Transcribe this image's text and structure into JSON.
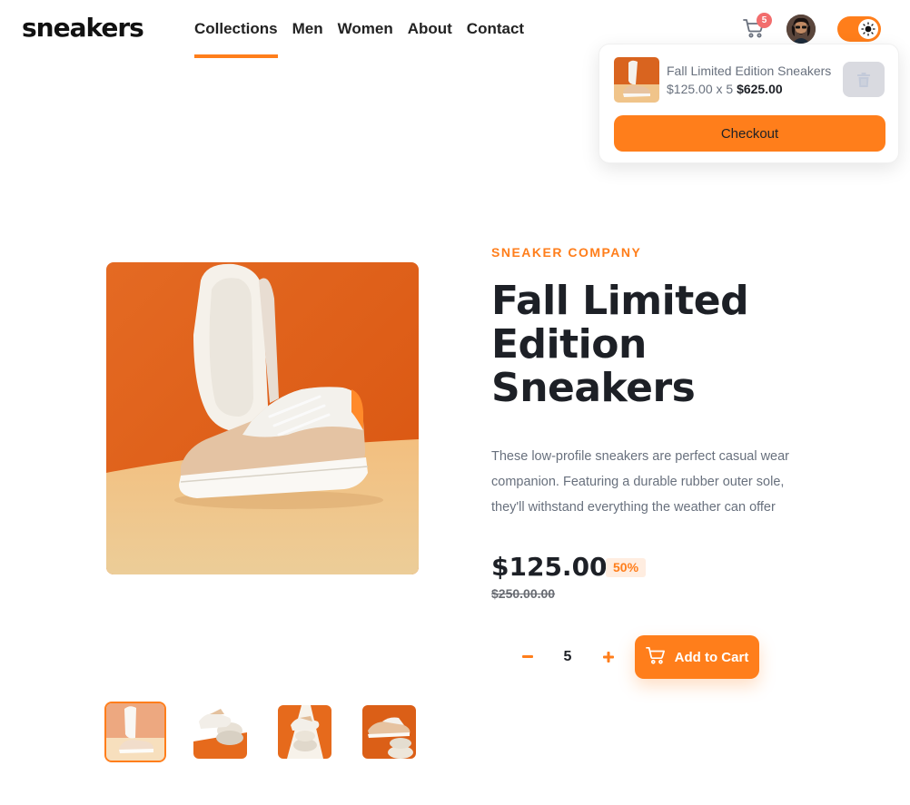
{
  "header": {
    "logo": "sneakers",
    "nav": [
      {
        "label": "Collections",
        "active": true
      },
      {
        "label": "Men",
        "active": false
      },
      {
        "label": "Women",
        "active": false
      },
      {
        "label": "About",
        "active": false
      },
      {
        "label": "Contact",
        "active": false
      }
    ],
    "cart_count": "5",
    "cart_icon": "cart-icon",
    "avatar": "user-avatar",
    "theme_toggle_icon": "sun-icon"
  },
  "cart": {
    "item_name": "Fall Limited Edition Sneakers",
    "unit_price": "$125.00",
    "quantity_text": "x 5",
    "total": "$625.00",
    "delete_icon": "trash-icon",
    "checkout_label": "Checkout"
  },
  "product": {
    "company": "SNEAKER COMPANY",
    "title": "Fall Limited Edition Sneakers",
    "description": "These low-profile sneakers are perfect casual wear companion. Featuring a durable rubber outer sole, they'll withstand everything the weather can offer",
    "price": "$125.00",
    "discount": "50%",
    "original_price": "$250.00.00",
    "quantity": "5",
    "minus_icon": "minus-icon",
    "plus_icon": "plus-icon",
    "add_to_cart_label": "Add to Cart"
  },
  "colors": {
    "accent": "#ff7e1b",
    "accent_pale": "#ffede0",
    "dark": "#1d2026",
    "muted": "#68707d",
    "badge": "#f26d6d"
  }
}
